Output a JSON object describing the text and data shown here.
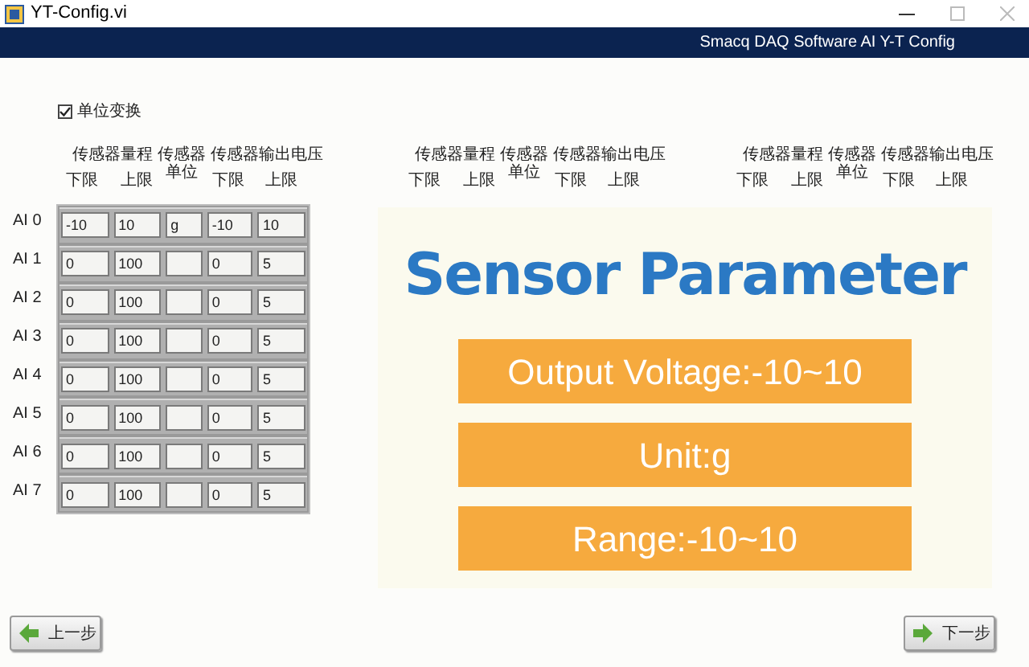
{
  "window": {
    "title": "YT-Config.vi"
  },
  "banner": "Smacq DAQ Software AI Y-T Config",
  "unit_conversion": {
    "label": "单位变换",
    "checked": true
  },
  "header_groups": [
    {
      "range": "传感器量程",
      "range_lower": "下限",
      "range_upper": "上限",
      "unit": "传感器单位",
      "output": "传感器输出电压",
      "out_lower": "下限",
      "out_upper": "上限"
    },
    {
      "range": "传感器量程",
      "range_lower": "下限",
      "range_upper": "上限",
      "unit": "传感器单位",
      "output": "传感器输出电压",
      "out_lower": "下限",
      "out_upper": "上限"
    },
    {
      "range": "传感器量程",
      "range_lower": "下限",
      "range_upper": "上限",
      "unit": "传感器单位",
      "output": "传感器输出电压",
      "out_lower": "下限",
      "out_upper": "上限"
    }
  ],
  "channels": [
    {
      "label": "AI 0",
      "range_lower": "-10",
      "range_upper": "10",
      "unit": "g",
      "out_lower": "-10",
      "out_upper": "10"
    },
    {
      "label": "AI 1",
      "range_lower": "0",
      "range_upper": "100",
      "out_lower": "0",
      "out_upper": "5"
    },
    {
      "label": "AI 2",
      "range_lower": "0",
      "range_upper": "100",
      "out_lower": "0",
      "out_upper": "5"
    },
    {
      "label": "AI 3",
      "range_lower": "0",
      "range_upper": "100",
      "out_lower": "0",
      "out_upper": "5"
    },
    {
      "label": "AI 4",
      "range_lower": "0",
      "range_upper": "100",
      "out_lower": "0",
      "out_upper": "5"
    },
    {
      "label": "AI 5",
      "range_lower": "0",
      "range_upper": "100",
      "out_lower": "0",
      "out_upper": "5"
    },
    {
      "label": "AI 6",
      "range_lower": "0",
      "range_upper": "100",
      "out_lower": "0",
      "out_upper": "5"
    },
    {
      "label": "AI 7",
      "range_lower": "0",
      "range_upper": "100",
      "out_lower": "0",
      "out_upper": "5"
    }
  ],
  "slide": {
    "title": "Sensor Parameter",
    "items": [
      "Output Voltage:-10~10",
      "Unit:g",
      "Range:-10~10"
    ]
  },
  "buttons": [
    {
      "label": "上一步",
      "kind": "back"
    },
    {
      "label": "下一步",
      "kind": "next"
    }
  ]
}
